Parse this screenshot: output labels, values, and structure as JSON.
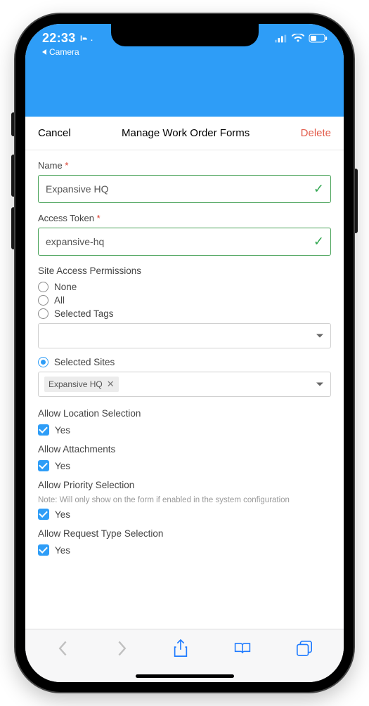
{
  "statusbar": {
    "time": "22:33",
    "back_app": "Camera"
  },
  "nav": {
    "cancel": "Cancel",
    "title": "Manage Work Order Forms",
    "delete": "Delete"
  },
  "form": {
    "name_label": "Name",
    "name_value": "Expansive HQ",
    "name_valid": true,
    "token_label": "Access Token",
    "token_value": "expansive-hq",
    "token_valid": true,
    "permissions_label": "Site Access Permissions",
    "radios": {
      "none": "None",
      "all": "All",
      "selected_tags": "Selected Tags",
      "selected_sites": "Selected Sites"
    },
    "selected_sites_chip": "Expansive HQ",
    "allow_location_label": "Allow Location Selection",
    "allow_location_yes": "Yes",
    "allow_attachments_label": "Allow Attachments",
    "allow_attachments_yes": "Yes",
    "allow_priority_label": "Allow Priority Selection",
    "allow_priority_note": "Note: Will only show on the form if enabled in the system configuration",
    "allow_priority_yes": "Yes",
    "allow_reqtype_label": "Allow Request Type Selection",
    "allow_reqtype_yes": "Yes"
  }
}
